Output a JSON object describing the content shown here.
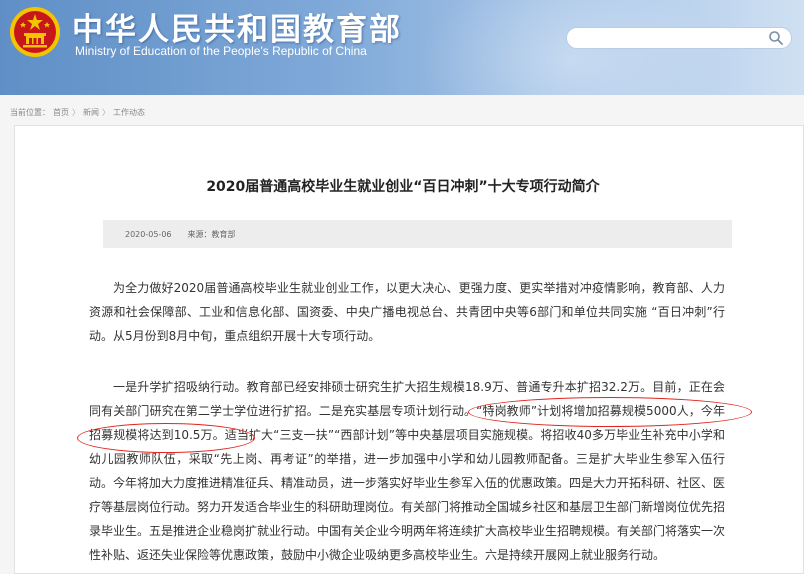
{
  "header": {
    "title": "中华人民共和国教育部",
    "subtitle": "Ministry of Education of the People's Republic of China",
    "search": {
      "placeholder": ""
    }
  },
  "breadcrumb": {
    "prefix": "当前位置：",
    "items": [
      "首页",
      "新闻",
      "工作动态"
    ],
    "separator": "〉"
  },
  "article": {
    "title": "2020届普通高校毕业生就业创业“百日冲刺”十大专项行动简介",
    "date": "2020-05-06",
    "source": "来源：教育部",
    "paragraphs": [
      "为全力做好2020届普通高校毕业生就业创业工作，以更大决心、更强力度、更实举措对冲疫情影响，教育部、人力资源和社会保障部、工业和信息化部、国资委、中央广播电视总台、共青团中央等6部门和单位共同实施 “百日冲刺”行动。从5月份到8月中旬，重点组织开展十大专项行动。",
      "一是升学扩招吸纳行动。教育部已经安排硕士研究生扩大招生规模18.9万、普通专升本扩招32.2万。目前，正在会同有关部门研究在第二学士学位进行扩招。二是充实基层专项计划行动。“特岗教师”计划将增加招募规模5000人，今年招募规模将达到10.5万。适当扩大“三支一扶”“西部计划”等中央基层项目实施规模。将招收40多万毕业生补充中小学和幼儿园教师队伍，采取“先上岗、再考证”的举措，进一步加强中小学和幼儿园教师配备。三是扩大毕业生参军入伍行动。今年将加大力度推进精准征兵、精准动员，进一步落实好毕业生参军入伍的优惠政策。四是大力开拓科研、社区、医疗等基层岗位行动。努力开发适合毕业生的科研助理岗位。有关部门将推动全国城乡社区和基层卫生部门新增岗位优先招录毕业生。五是推进企业稳岗扩就业行动。中国有关企业今明两年将连续扩大高校毕业生招聘规模。有关部门将落实一次性补贴、返还失业保险等优惠政策，鼓励中小微企业吸纳更多高校毕业生。六是持续开展网上就业服务行动。"
    ]
  },
  "colors": {
    "header_blue": "#5f8fc6",
    "annotation_red": "#e0261e",
    "emblem_red": "#c8161d",
    "emblem_gold": "#f5c400"
  }
}
